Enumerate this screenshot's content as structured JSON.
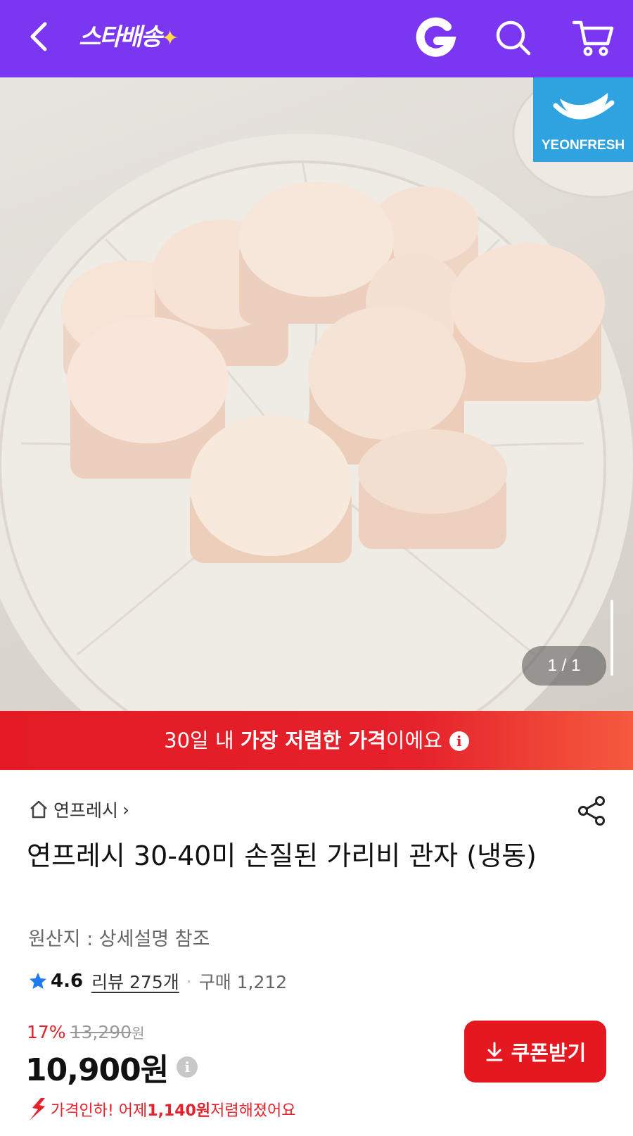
{
  "header": {
    "logo_text": "스타배송",
    "logo_spark": "✦",
    "colors": {
      "bg": "#7b36f2",
      "icon": "#ffffff",
      "spark": "#ffd84a"
    },
    "icons": [
      "back-icon",
      "g-logo-icon",
      "search-icon",
      "cart-icon"
    ]
  },
  "hero": {
    "brand_badge_text": "YEONFRESH",
    "counter": "1 / 1",
    "image_description_icon": "product-photo"
  },
  "promo": {
    "part1": "30일 내 ",
    "bold": "가장 저렴한 가격",
    "part2": "이에요",
    "info_symbol": "i",
    "colors": {
      "bg": "#e5212b"
    }
  },
  "product": {
    "store_name": "연프레시",
    "store_chevron": "›",
    "title": "연프레시 30-40미 손질된 가리비 관자 (냉동)",
    "origin": "원산지 : 상세설명 참조",
    "rating": "4.6",
    "review_label": "리뷰 275개",
    "dot": "·",
    "purchase_label": "구매 1,212",
    "discount": "17%",
    "original_price": "13,290",
    "original_won": "원",
    "price": "10,900원",
    "price_info": "i",
    "coupon_button": "쿠폰받기",
    "price_drop_part1": "가격인하! 어제 ",
    "price_drop_amount": "1,140원",
    "price_drop_part2": " 저렴해졌어요",
    "colors": {
      "accent": "#e5212b",
      "star": "#1f7cf0"
    }
  }
}
